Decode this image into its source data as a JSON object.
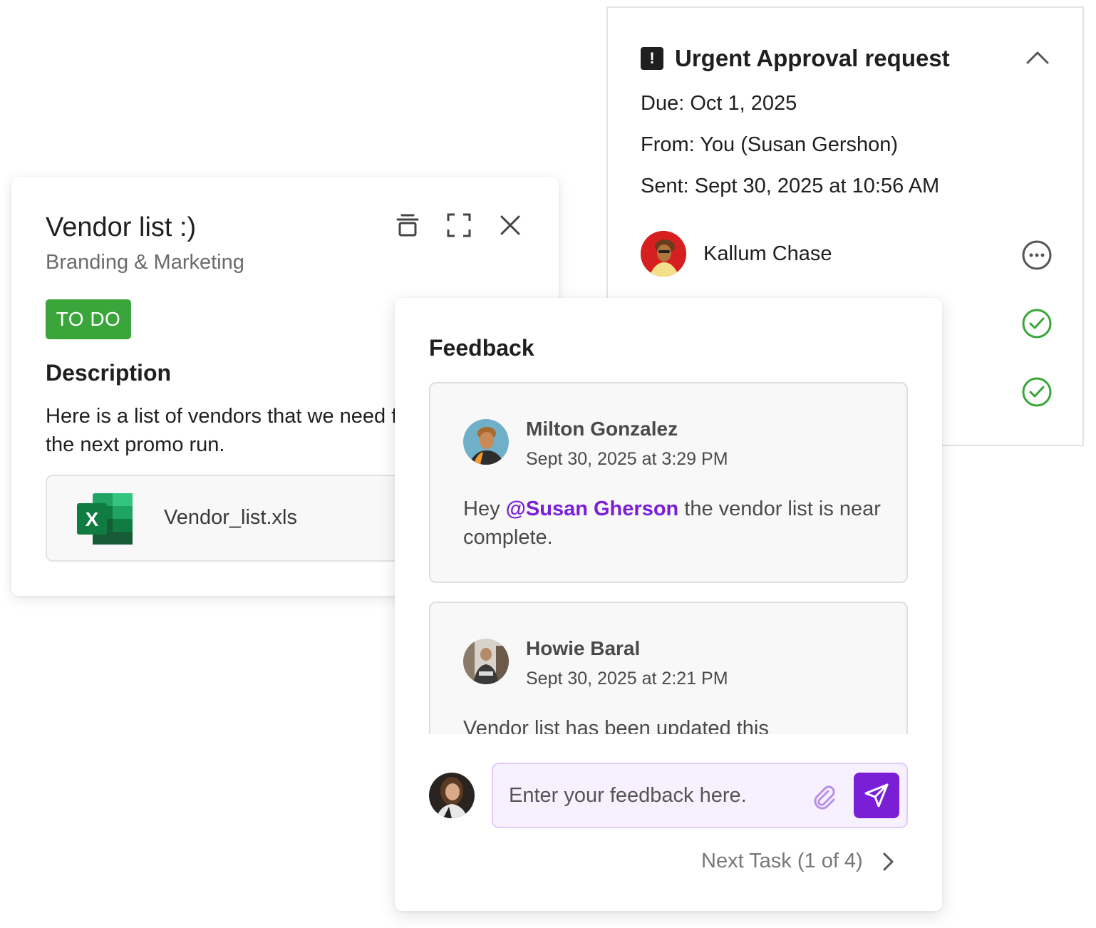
{
  "approval": {
    "title": "Urgent Approval request",
    "due": "Due: Oct 1, 2025",
    "from": "From: You (Susan Gershon)",
    "sent": "Sent:  Sept 30, 2025 at 10:56 AM",
    "approvers": [
      {
        "name": "Kallum Chase",
        "status": "pending",
        "status_icon": "more-horizontal-icon"
      },
      {
        "status": "approved",
        "status_icon": "check-circle-icon"
      },
      {
        "status": "approved",
        "status_icon": "check-circle-icon"
      }
    ],
    "colors": {
      "approved": "#3aa53a",
      "pending": "#555555"
    }
  },
  "task": {
    "title": "Vendor list :)",
    "project": "Branding & Marketing",
    "status_badge": "TO DO",
    "status_color": "#3aa53a",
    "description_heading": "Description",
    "description": "Here is a list of vendors that we need for the next promo run.",
    "toolbar": [
      "trash-icon",
      "expand-icon",
      "close-icon"
    ],
    "attachment": {
      "file_name": "Vendor_list.xls",
      "icon": "excel-icon"
    }
  },
  "feedback": {
    "title": "Feedback",
    "comments": [
      {
        "author": "Milton Gonzalez",
        "time": "Sept 30, 2025 at 3:29 PM",
        "body_prefix": "Hey ",
        "mention": "@Susan Gherson",
        "body_suffix": " the vendor list is near complete."
      },
      {
        "author": "Howie Baral",
        "time": "Sept 30, 2025 at 2:21 PM",
        "body": "Vendor list has been updated this"
      }
    ],
    "input_placeholder": "Enter your feedback here.",
    "next_task_label": "Next Task (1 of 4)",
    "accent_color": "#7a1fd6"
  }
}
